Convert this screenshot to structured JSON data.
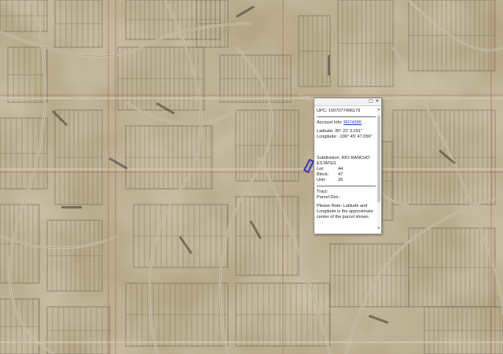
{
  "colors": {
    "terrain_base": "#b9aa86",
    "parcel_line": "#5a5242",
    "road_line": "#d8cfb6",
    "section_line": "#c0504d",
    "selected_parcel": "#3a2fb3"
  },
  "popup": {
    "icons": [
      "maximize-icon",
      "close-icon"
    ],
    "upc": "UPC: 1007077496179",
    "account_label": "Account Info: ",
    "account_value": "R074395",
    "latitude": "Latitude: 35° 22' 3.291\"",
    "longitude": "Longitude: -106° 45' 47.056\"",
    "subdivision_label": "Subdivision: RIO RANCHO",
    "subdivision_cont": "ESTATES",
    "lot_label": "Lot:",
    "lot_value": "44",
    "block_label": "Block:",
    "block_value": "47",
    "unit_label": "Unit:",
    "unit_value": "26",
    "tract_label": "Tract:",
    "parcel_des_label": "Parcel Des.:",
    "note": "Please Note: Latitude and Longitude is the approximate center of the parcel shown."
  }
}
